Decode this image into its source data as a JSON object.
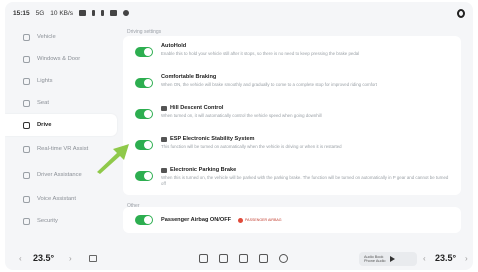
{
  "statusbar": {
    "time": "15:15",
    "network": "5G",
    "speed": "10 KB/s"
  },
  "sidebar": {
    "items": [
      {
        "label": "Vehicle"
      },
      {
        "label": "Windows & Door"
      },
      {
        "label": "Lights"
      },
      {
        "label": "Seat"
      },
      {
        "label": "Drive"
      },
      {
        "label": "Real-time VR Assist"
      },
      {
        "label": "Driver Assistance"
      },
      {
        "label": "Voice Assistant"
      },
      {
        "label": "Security"
      }
    ],
    "active_index": 4
  },
  "content": {
    "section_title": "Driving settings",
    "settings": [
      {
        "title": "AutoHold",
        "description": "Enable this to hold your vehicle still after it stops, so there is no need to keep pressing the brake pedal",
        "enabled": true
      },
      {
        "title": "Comfortable Braking",
        "description": "When ON, the vehicle will brake smoothly and gradually to come to a complete stop for improved riding comfort",
        "enabled": true
      },
      {
        "title": "Hill Descent Control",
        "description": "When turned on, it will automatically control the vehicle speed when going downhill",
        "enabled": true
      },
      {
        "title": "ESP Electronic Stability System",
        "description": "This function will be turned on automatically when the vehicle is driving or when it is restarted",
        "enabled": true
      },
      {
        "title": "Electronic Parking Brake",
        "description": "When this is turned on, the vehicle will be parked with the parking brake. The function will be turned on automatically in P gear and cannot be turned off",
        "enabled": true
      }
    ],
    "other_title": "Other",
    "other_settings": [
      {
        "title": "Passenger Airbag ON/OFF",
        "badge": "PASSENGER AIRBAG",
        "enabled": true
      }
    ]
  },
  "bottombar": {
    "temp_left": "23.5°",
    "temp_right": "23.5°",
    "media_label": "Audio Book",
    "media_sub": "Phone Audio"
  },
  "colors": {
    "toggle_on": "#2dae50",
    "arrow": "#8fc94a"
  }
}
